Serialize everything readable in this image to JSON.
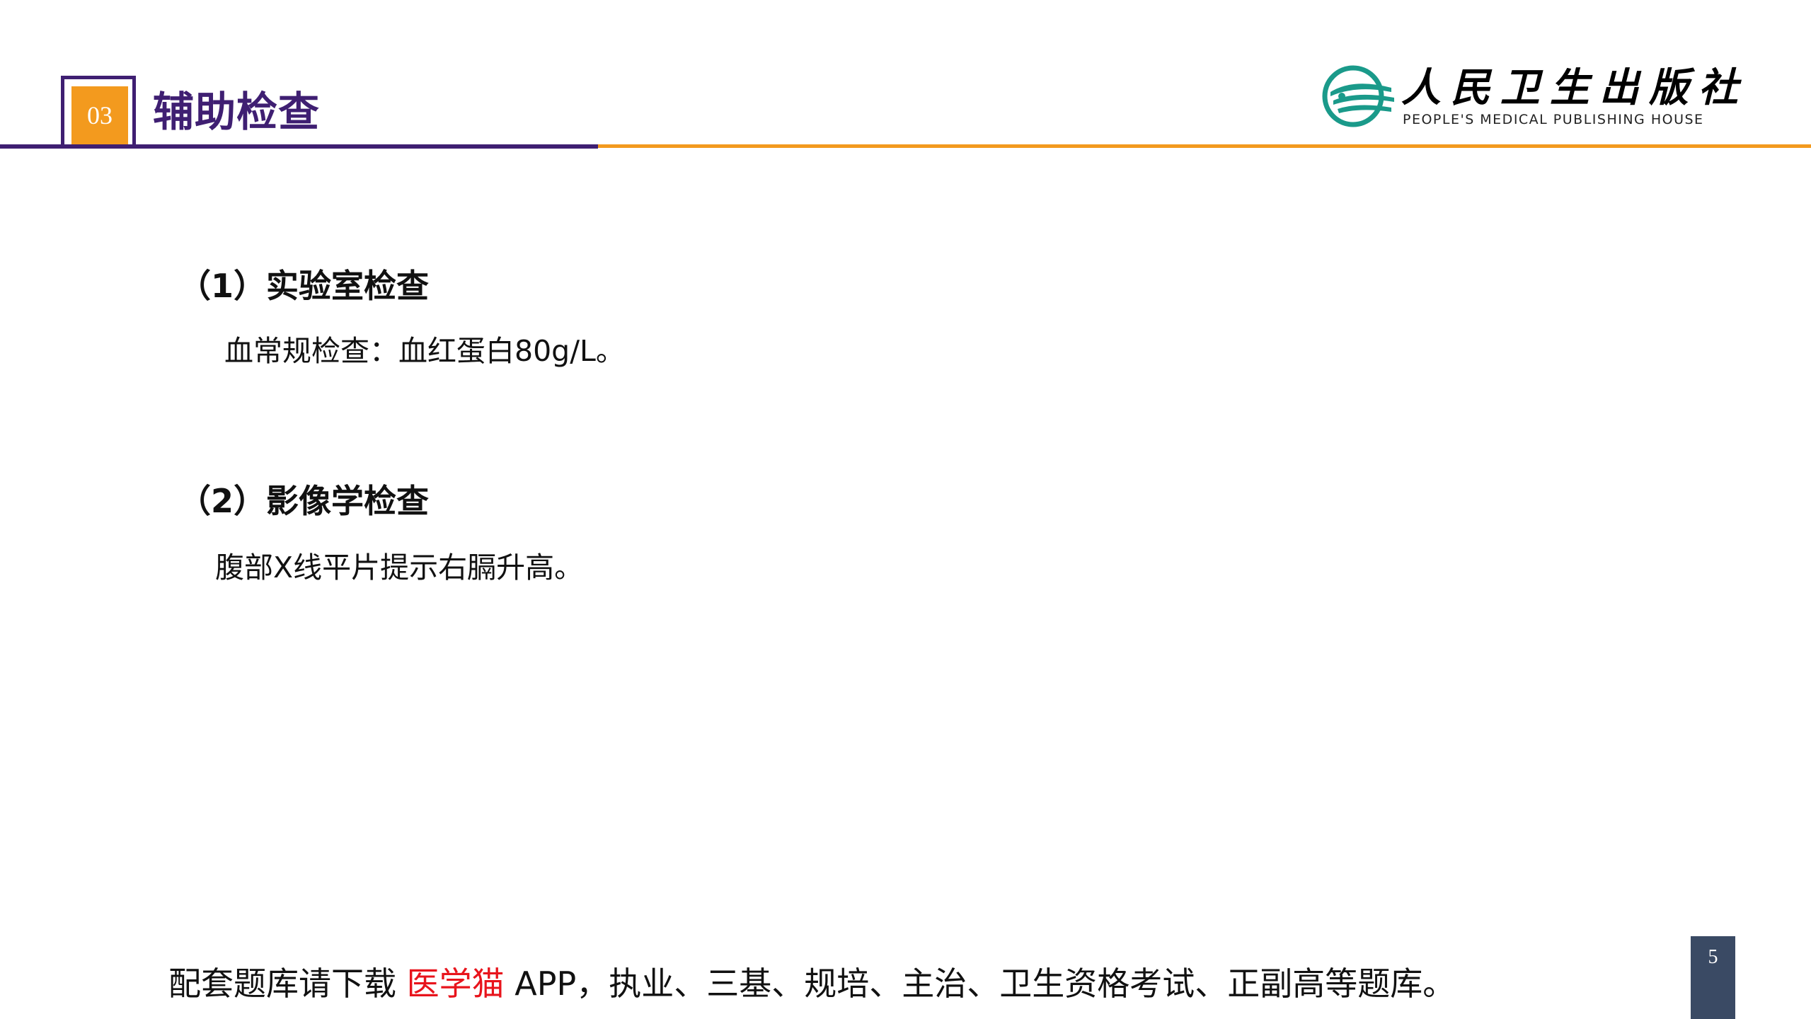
{
  "header": {
    "section_number": "03",
    "section_title": "辅助检查",
    "colors": {
      "purple": "#3f1f72",
      "orange": "#f39a1e"
    }
  },
  "logo": {
    "icon": "publisher-logo-icon",
    "name_cn": "人民卫生出版社",
    "name_en": "PEOPLE'S MEDICAL PUBLISHING HOUSE",
    "color": "#1a9a8a"
  },
  "content": {
    "sections": [
      {
        "heading": "（1）实验室检查",
        "text": "血常规检查：血红蛋白80g/L。"
      },
      {
        "heading": "（2）影像学检查",
        "text": "腹部X线平片提示右膈升高。"
      }
    ]
  },
  "footer": {
    "prefix": "配套题库请下载 ",
    "highlight": "医学猫",
    "suffix": " APP，执业、三基、规培、主治、卫生资格考试、正副高等题库。",
    "highlight_color": "#e8141c"
  },
  "page": {
    "number": "5"
  }
}
